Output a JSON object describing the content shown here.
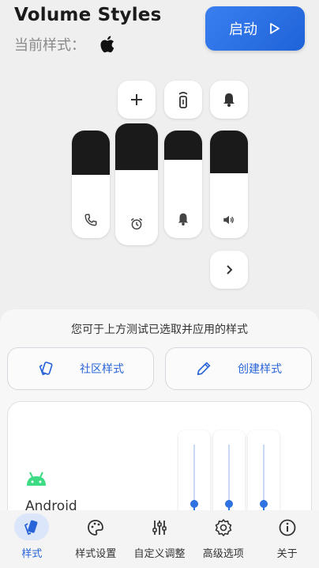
{
  "header": {
    "app_title": "Volume Styles",
    "current_style_label": "当前样式：",
    "current_style_icon": "apple-icon",
    "start_label": "启动"
  },
  "preview": {
    "top_buttons": [
      "plus-icon",
      "remote-icon",
      "bell-icon"
    ],
    "sliders": [
      {
        "name": "call",
        "icon": "phone-icon",
        "level": 0.41
      },
      {
        "name": "alarm",
        "icon": "alarm-icon",
        "level": 0.38
      },
      {
        "name": "notification",
        "icon": "bell-icon",
        "level": 0.27
      },
      {
        "name": "media",
        "icon": "speaker-icon",
        "level": 0.4
      }
    ],
    "expand_icon": "chevron-right-icon"
  },
  "panel": {
    "hint": "您可于上方测试已选取并应用的样式",
    "community_label": "社区样式",
    "create_label": "创建样式",
    "style_card": {
      "name": "Android",
      "logo": "android-icon",
      "mini_slider_levels": [
        0.55,
        0.55,
        0.55
      ]
    }
  },
  "nav": {
    "items": [
      {
        "label": "样式",
        "icon": "style-icon",
        "active": true
      },
      {
        "label": "样式设置",
        "icon": "palette-icon",
        "active": false
      },
      {
        "label": "自定义调整",
        "icon": "tune-icon",
        "active": false
      },
      {
        "label": "高级选项",
        "icon": "settings-icon",
        "active": false
      },
      {
        "label": "关于",
        "icon": "info-icon",
        "active": false
      }
    ]
  },
  "colors": {
    "accent": "#2864d8",
    "slider_fill": "#1a1a1a",
    "background": "#efefef"
  }
}
